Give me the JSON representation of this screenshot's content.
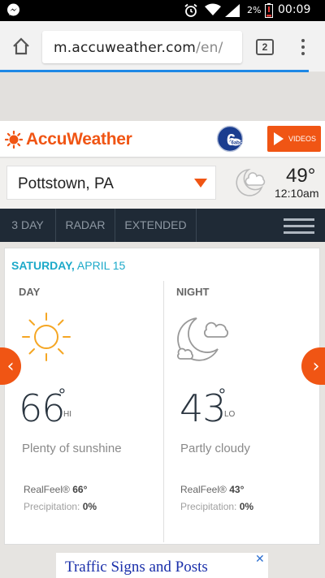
{
  "status_bar": {
    "battery_percent": "2%",
    "time": "00:09",
    "icons": [
      "messenger-icon",
      "alarm-icon",
      "wifi-icon",
      "signal-icon",
      "battery-low-icon"
    ]
  },
  "browser": {
    "url_host": "m.accuweather.com",
    "url_path": "/en/",
    "tab_count": "2",
    "page_load_progress": 0.95,
    "accent_color": "#1e88e5"
  },
  "header": {
    "brand": "AccuWeather",
    "brand_color": "#f05514",
    "partner_logo": "6abc",
    "videos_label": "VIDEOS"
  },
  "location": {
    "city": "Pottstown, PA",
    "current_temp": "49°",
    "current_time": "12:10am",
    "current_icon": "partly-cloudy-night-icon"
  },
  "nav": {
    "tabs": [
      "3 DAY",
      "RADAR",
      "EXTENDED"
    ],
    "menu_icon": "hamburger-icon"
  },
  "forecast": {
    "weekday": "SATURDAY,",
    "date": "APRIL 15",
    "day": {
      "label": "DAY",
      "icon": "sunny-icon",
      "temp": "66",
      "deg": "°",
      "hilo": "HI",
      "phrase": "Plenty of sunshine",
      "realfeel_label": "RealFeel®",
      "realfeel_value": "66°",
      "precip_label": "Precipitation:",
      "precip_value": "0%"
    },
    "night": {
      "label": "NIGHT",
      "icon": "partly-cloudy-night-icon",
      "temp": "43",
      "deg": "°",
      "hilo": "LO",
      "phrase": "Partly cloudy",
      "realfeel_label": "RealFeel®",
      "realfeel_value": "43°",
      "precip_label": "Precipitation:",
      "precip_value": "0%"
    },
    "prev_label": "‹",
    "next_label": "›"
  },
  "ad": {
    "text": "Traffic Signs and Posts",
    "close": "✕"
  }
}
